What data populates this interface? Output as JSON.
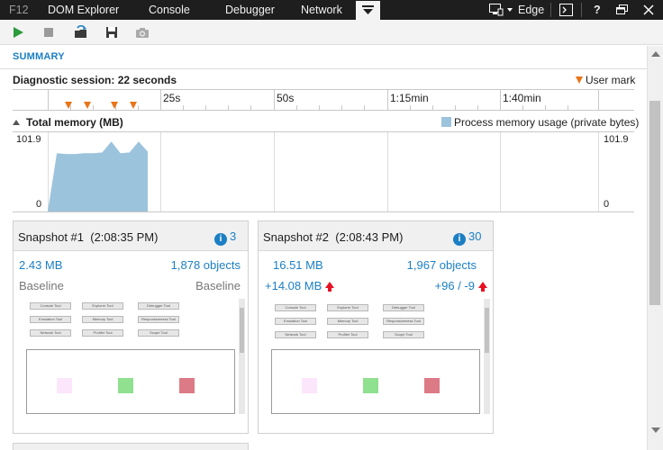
{
  "tabs": {
    "f12": "F12",
    "dom_explorer": "DOM Explorer",
    "console": "Console",
    "debugger": "Debugger",
    "network": "Network",
    "more_icon": "chevron-down-icon"
  },
  "topbar_right": {
    "emulation_label": "Edge",
    "help_label": "?"
  },
  "toolbar": {
    "icons": [
      "play-icon",
      "stop-icon",
      "import-icon",
      "save-icon",
      "camera-icon"
    ]
  },
  "summary": {
    "tab_label": "SUMMARY",
    "session_label": "Diagnostic session: 22 seconds",
    "user_mark_label": "User mark",
    "timeline_labels": [
      "25s",
      "50s",
      "1:15min",
      "1:40min"
    ]
  },
  "memory": {
    "title": "Total memory (MB)",
    "legend_label": "Process memory usage (private bytes)",
    "y_max_label": "101.9",
    "y_min_label": "0"
  },
  "chart_data": {
    "type": "area",
    "title": "Total memory (MB)",
    "xlabel": "",
    "ylabel": "",
    "ylim": [
      0,
      101.9
    ],
    "x_tick_labels": [
      "25s",
      "50s",
      "1:15min",
      "1:40min"
    ],
    "series": [
      {
        "name": "Process memory usage (private bytes)",
        "color": "#9cc3dc",
        "x": [
          0,
          2,
          4,
          6,
          8,
          10,
          12,
          14,
          16,
          18,
          20,
          22
        ],
        "values": [
          0,
          75,
          74,
          74,
          75,
          75,
          76,
          90,
          75,
          76,
          90,
          77
        ]
      }
    ]
  },
  "snapshots": [
    {
      "title": "Snapshot #1",
      "time": "(2:08:35 PM)",
      "info_count": "3",
      "size": "2.43 MB",
      "objects": "1,878 objects",
      "size_sub": "Baseline",
      "objects_sub": "Baseline"
    },
    {
      "title": "Snapshot #2",
      "time": "(2:08:43 PM)",
      "info_count": "30",
      "size": "16.51 MB",
      "objects": "1,967 objects",
      "size_delta": "+14.08 MB",
      "objects_delta": "+96 / -9"
    }
  ],
  "thumbnail_buttons": [
    "Console Tool",
    "Explorer Tool",
    "Debugger Tool",
    "Emulation Tool",
    "Memory Tool",
    "Responsiveness Tool",
    "Network Tool",
    "Profiler Tool",
    "Scope Tool"
  ],
  "colors": {
    "accent": "#1c7fc4",
    "user_mark": "#e8751a",
    "memory_fill": "#9cc3dc",
    "increase_arrow": "#e81123"
  }
}
